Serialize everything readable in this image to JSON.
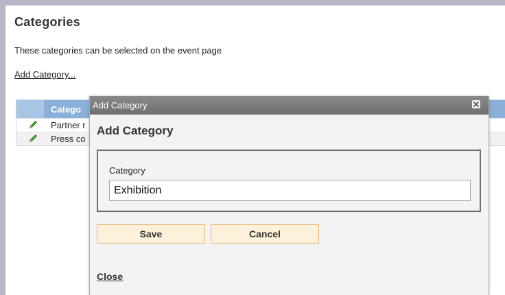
{
  "page": {
    "title": "Categories",
    "description": "These categories can be selected on the event page",
    "add_link": "Add Category..."
  },
  "table": {
    "header": "Catego",
    "rows": [
      {
        "label": "Partner r",
        "icon": "pencil-icon"
      },
      {
        "label": "Press co",
        "icon": "pencil-icon"
      }
    ]
  },
  "dialog": {
    "titlebar": "Add Category",
    "heading": "Add Category",
    "field_label": "Category",
    "field_value": "Exhibition",
    "save_label": "Save",
    "cancel_label": "Cancel",
    "close_link": "Close",
    "close_icon": "close-icon"
  },
  "colors": {
    "table_header": "#8ab0d8",
    "button_bg": "#fdf1dc",
    "button_border": "#e8b46d",
    "titlebar": "#7c7c7c"
  }
}
